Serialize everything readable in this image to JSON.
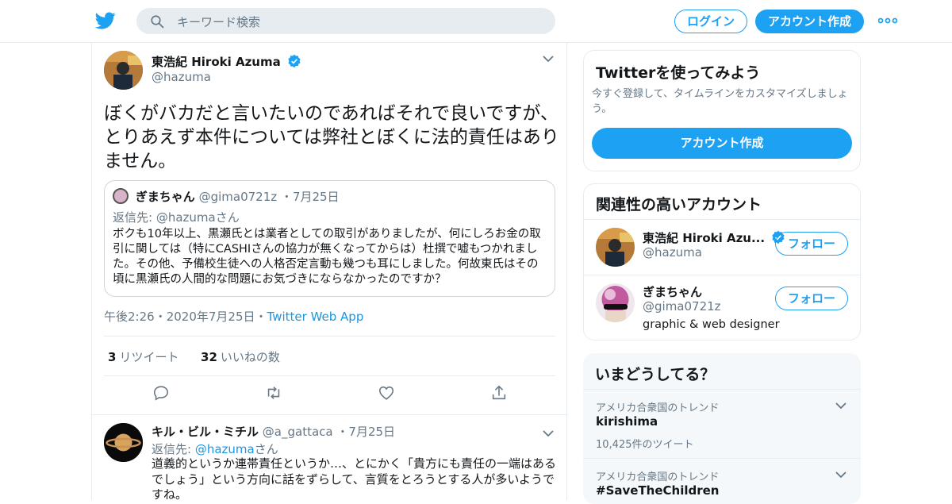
{
  "header": {
    "search_placeholder": "キーワード検索",
    "login_label": "ログイン",
    "signup_label": "アカウント作成"
  },
  "tweet": {
    "author_name": "東浩紀 Hiroki Azuma",
    "author_handle": "@hazuma",
    "text": "ぼくがバカだと言いたいのであればそれで良いですが、とりあえず本件については弊社とぼくに法的責任はありません。",
    "quote": {
      "author_name": "ぎまちゃん",
      "author_handle": "@gima0721z",
      "sep": "・",
      "date": "7月25日",
      "reply_to": "返信先: @hazumaさん",
      "body": "ボクも10年以上、黒瀬氏とは業者としての取引がありましたが、何にしろお金の取引に関しては（特にCASHIさんの協力が無くなってからは）杜撰で嘘もつかれました。その他、予備校生徒への人格否定言動も幾つも耳にしました。何故東氏はその頃に黒瀬氏の人間的な問題にお気づきにならなかったのですか？"
    },
    "time": "午後2:26",
    "sep": "・",
    "date": "2020年7月25日",
    "source": "Twitter Web App",
    "retweets": "3",
    "retweets_label": "リツイート",
    "likes": "32",
    "likes_label": "いいねの数"
  },
  "reply": {
    "author_name": "キル・ビル・ミチル",
    "author_handle": "@a_gattaca",
    "sep": "・",
    "date": "7月25日",
    "reply_prefix": "返信先:",
    "reply_handle": "@hazuma",
    "reply_suffix": "さん",
    "body": "道義的というか連帯責任というか…、とにかく「貴方にも責任の一端はあるでしょう」という方向に話をずらして、言質をとろうとする人が多いようですね。"
  },
  "sidebar": {
    "signup_card": {
      "title": "Twitterを使ってみよう",
      "desc": "今すぐ登録して、タイムラインをカスタマイズしましょう。",
      "button": "アカウント作成"
    },
    "related": {
      "title": "関連性の高いアカウント",
      "accounts": [
        {
          "name": "東浩紀 Hiroki Azu...",
          "handle": "@hazuma",
          "bio": "",
          "follow": "フォロー"
        },
        {
          "name": "ぎまちゃん",
          "handle": "@gima0721z",
          "bio": "graphic & web designer",
          "follow": "フォロー"
        }
      ]
    },
    "trends": {
      "title": "いまどうしてる？",
      "items": [
        {
          "context": "アメリカ合衆国のトレンド",
          "name": "kirishima",
          "count": "10,425件のツイート"
        },
        {
          "context": "アメリカ合衆国のトレンド",
          "name": "#SaveTheChildren",
          "count": ""
        }
      ]
    }
  },
  "colors": {
    "accent": "#1da1f2",
    "link": "#1b95e0",
    "muted": "#657786"
  },
  "icons": [
    "twitter-bird-icon",
    "search-icon",
    "more-icon",
    "verified-icon",
    "chevron-down-icon",
    "reply-icon",
    "retweet-icon",
    "like-icon",
    "share-icon"
  ]
}
